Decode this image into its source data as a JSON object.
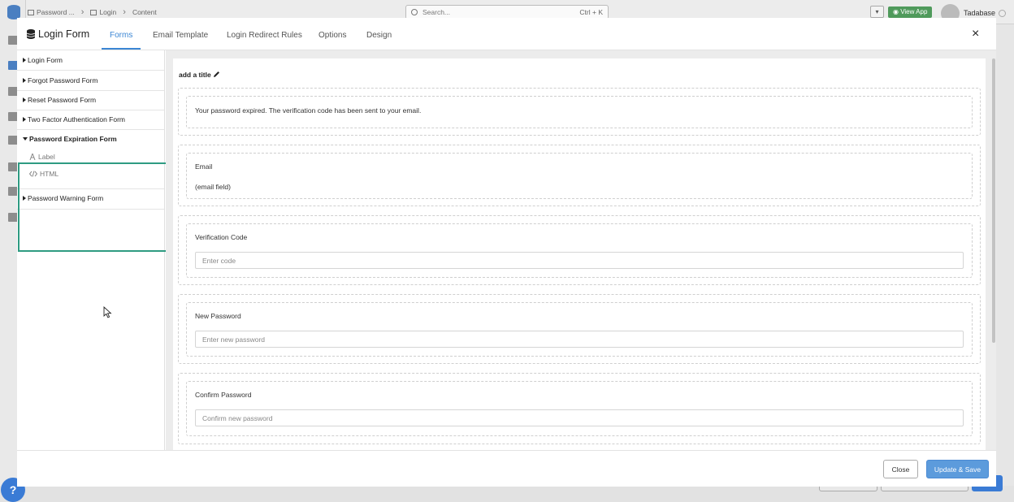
{
  "background": {
    "breadcrumbs": [
      "Password ...",
      "Login",
      "Content"
    ],
    "search": {
      "placeholder": "Search...",
      "shortcut": "Ctrl + K"
    },
    "view_app_label": "View App",
    "user_name": "Tadabase",
    "help_label": "?"
  },
  "modal": {
    "title": "Login Form",
    "tabs": [
      {
        "label": "Forms",
        "active": true
      },
      {
        "label": "Email Template",
        "active": false
      },
      {
        "label": "Login Redirect Rules",
        "active": false
      },
      {
        "label": "Options",
        "active": false
      },
      {
        "label": "Design",
        "active": false
      }
    ],
    "close_icon": "×"
  },
  "tree": {
    "items": [
      {
        "label": "Login Form",
        "expanded": false
      },
      {
        "label": "Forgot Password Form",
        "expanded": false
      },
      {
        "label": "Reset Password Form",
        "expanded": false
      },
      {
        "label": "Two Factor Authentication Form",
        "expanded": false
      },
      {
        "label": "Password Expiration Form",
        "expanded": true,
        "children": [
          {
            "label": "Label",
            "icon": "text-icon"
          },
          {
            "label": "HTML",
            "icon": "code-icon"
          }
        ]
      },
      {
        "label": "Password Warning Form",
        "expanded": false
      }
    ]
  },
  "canvas": {
    "add_title": "add a title",
    "message": "Your password expired. The verification code has been sent to your email.",
    "email": {
      "label": "Email",
      "value": "(email field)"
    },
    "verification": {
      "label": "Verification Code",
      "placeholder": "Enter code"
    },
    "new_password": {
      "label": "New Password",
      "placeholder": "Enter new password"
    },
    "confirm_password": {
      "label": "Confirm Password",
      "placeholder": "Confirm new password"
    }
  },
  "footer": {
    "close_label": "Close",
    "save_label": "Update & Save"
  },
  "colors": {
    "accent": "#3b86d4",
    "highlight": "#2e9b82",
    "save_button": "#5c9bdc"
  }
}
